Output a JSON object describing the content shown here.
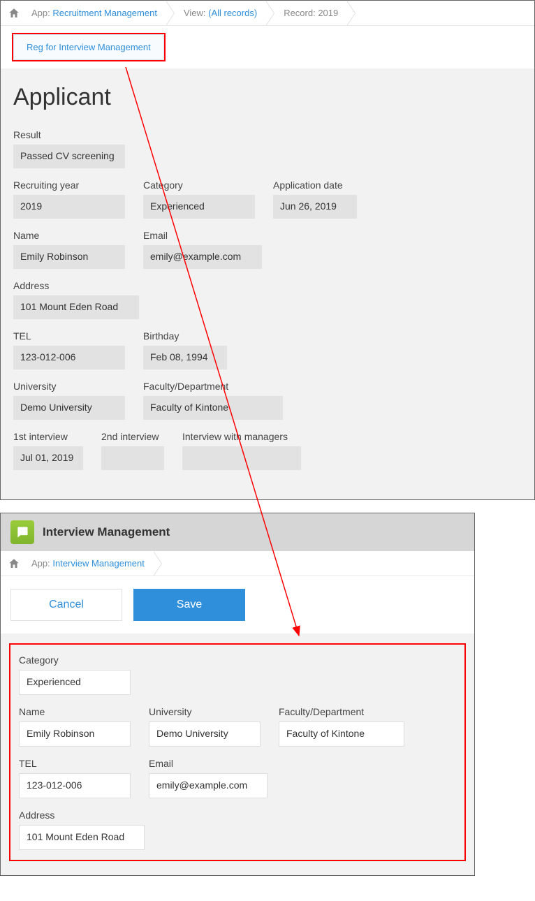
{
  "panel1": {
    "breadcrumb": {
      "app_prefix": "App: ",
      "app_link": "Recruitment Management",
      "view_prefix": "View: ",
      "view_link": "(All records)",
      "record": "Record: 2019"
    },
    "reg_button": "Reg for Interview Management",
    "title": "Applicant",
    "fields": {
      "result": {
        "label": "Result",
        "value": "Passed CV screening"
      },
      "recruiting_year": {
        "label": "Recruiting year",
        "value": "2019"
      },
      "category": {
        "label": "Category",
        "value": "Experienced"
      },
      "app_date": {
        "label": "Application date",
        "value": "Jun 26, 2019"
      },
      "name": {
        "label": "Name",
        "value": "Emily Robinson"
      },
      "email": {
        "label": "Email",
        "value": "emily@example.com"
      },
      "address": {
        "label": "Address",
        "value": "101 Mount Eden Road"
      },
      "tel": {
        "label": "TEL",
        "value": "123-012-006"
      },
      "birthday": {
        "label": "Birthday",
        "value": "Feb 08, 1994"
      },
      "university": {
        "label": "University",
        "value": "Demo University"
      },
      "faculty": {
        "label": "Faculty/Department",
        "value": "Faculty of Kintone"
      },
      "interview1": {
        "label": "1st interview",
        "value": "Jul 01, 2019"
      },
      "interview2": {
        "label": "2nd interview",
        "value": ""
      },
      "interview_mgr": {
        "label": "Interview with managers",
        "value": ""
      }
    }
  },
  "panel2": {
    "header_title": "Interview Management",
    "breadcrumb": {
      "app_prefix": "App: ",
      "app_link": "Interview Management"
    },
    "buttons": {
      "cancel": "Cancel",
      "save": "Save"
    },
    "fields": {
      "category": {
        "label": "Category",
        "value": "Experienced"
      },
      "name": {
        "label": "Name",
        "value": "Emily Robinson"
      },
      "university": {
        "label": "University",
        "value": "Demo University"
      },
      "faculty": {
        "label": "Faculty/Department",
        "value": "Faculty of Kintone"
      },
      "tel": {
        "label": "TEL",
        "value": "123-012-006"
      },
      "email": {
        "label": "Email",
        "value": "emily@example.com"
      },
      "address": {
        "label": "Address",
        "value": "101 Mount Eden Road"
      }
    }
  }
}
